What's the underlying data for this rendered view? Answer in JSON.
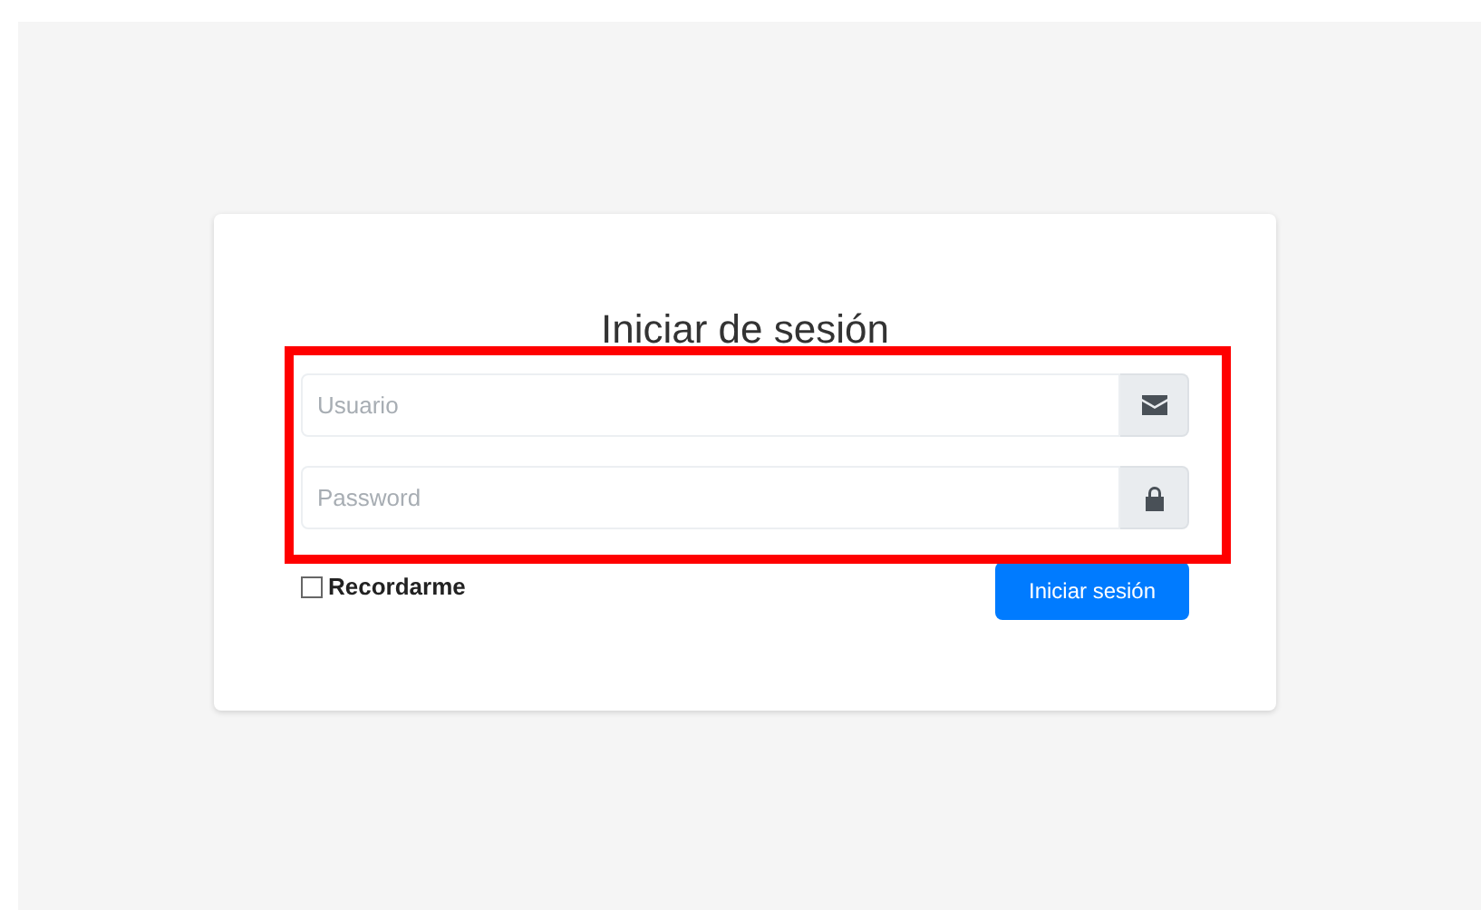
{
  "title": "Iniciar de sesión",
  "fields": [
    {
      "placeholder": "Usuario",
      "kind": "email"
    },
    {
      "placeholder": "Password",
      "kind": "password"
    }
  ],
  "remember": {
    "label": "Recordarme",
    "checked": false
  },
  "submit": {
    "label": "Iniciar sesión"
  },
  "highlight": {
    "shown": true
  }
}
